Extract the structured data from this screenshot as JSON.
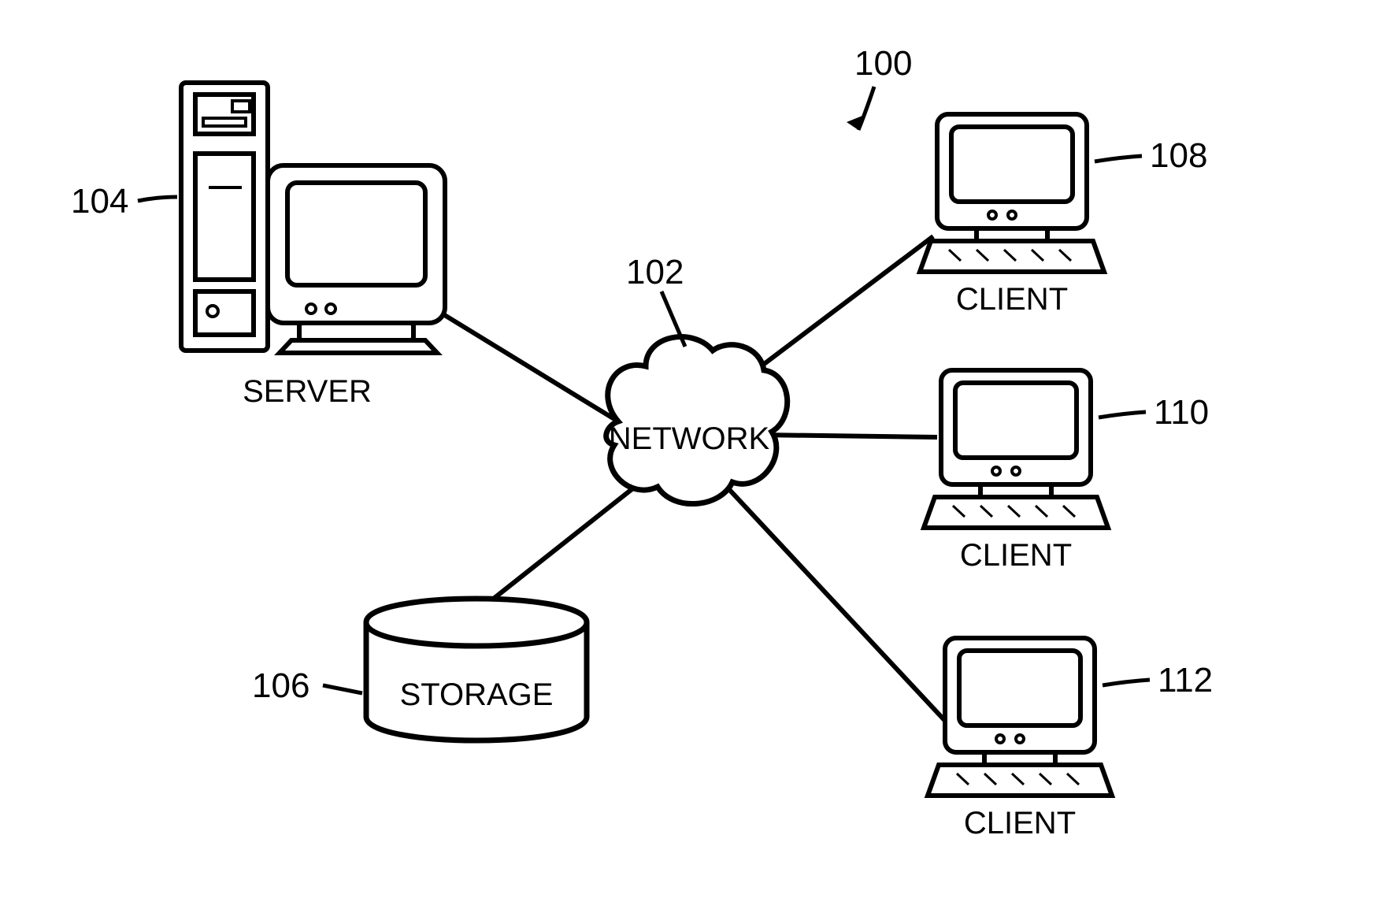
{
  "diagram_ref": "100",
  "network": {
    "label": "NETWORK",
    "ref": "102"
  },
  "server": {
    "label": "SERVER",
    "ref": "104"
  },
  "storage": {
    "label": "STORAGE",
    "ref": "106"
  },
  "client1": {
    "label": "CLIENT",
    "ref": "108"
  },
  "client2": {
    "label": "CLIENT",
    "ref": "110"
  },
  "client3": {
    "label": "CLIENT",
    "ref": "112"
  }
}
